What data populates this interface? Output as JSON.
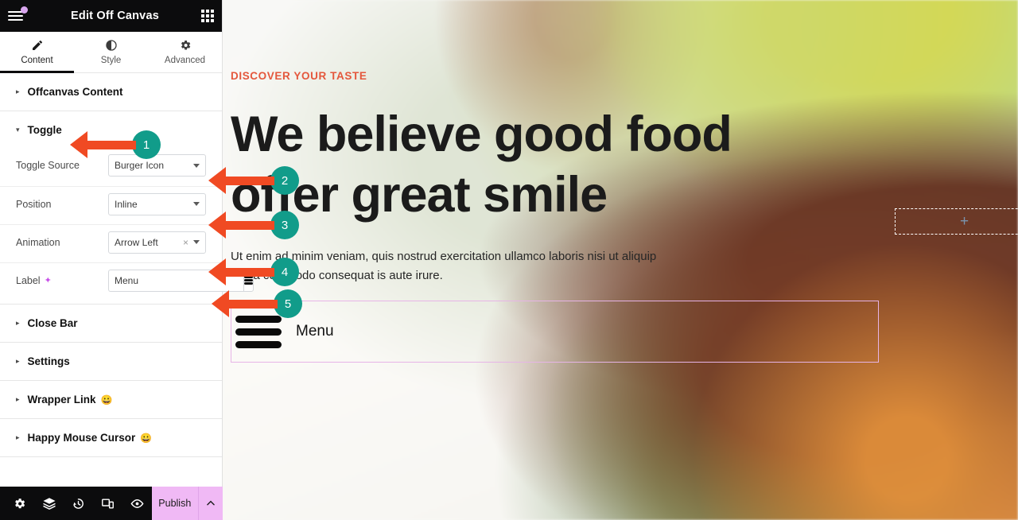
{
  "panel": {
    "header": {
      "title": "Edit Off Canvas",
      "menu_icon": "hamburger-icon",
      "apps_icon": "grid-apps-icon",
      "notification_dot_color": "#d9a6ee"
    },
    "tabs": [
      {
        "label": "Content",
        "icon": "pencil-icon",
        "active": true
      },
      {
        "label": "Style",
        "icon": "contrast-circle-icon",
        "active": false
      },
      {
        "label": "Advanced",
        "icon": "gear-icon",
        "active": false
      }
    ],
    "sections": [
      {
        "title": "Offcanvas Content",
        "state": "collapsed",
        "caret": "▸",
        "emoji": ""
      },
      {
        "title": "Toggle",
        "state": "expanded",
        "caret": "▾",
        "emoji": ""
      },
      {
        "title": "Close Bar",
        "state": "collapsed",
        "caret": "▸",
        "emoji": ""
      },
      {
        "title": "Settings",
        "state": "collapsed",
        "caret": "▸",
        "emoji": ""
      },
      {
        "title": "Wrapper Link",
        "state": "collapsed",
        "caret": "▸",
        "emoji": "😀"
      },
      {
        "title": "Happy Mouse Cursor",
        "state": "collapsed",
        "caret": "▸",
        "emoji": "😀"
      }
    ],
    "toggle_controls": [
      {
        "label": "Toggle Source",
        "type": "select",
        "value": "Burger Icon",
        "clearable": false,
        "sparkle": false
      },
      {
        "label": "Position",
        "type": "select",
        "value": "Inline",
        "clearable": false,
        "sparkle": false
      },
      {
        "label": "Animation",
        "type": "select",
        "value": "Arrow Left",
        "clearable": true,
        "clear_glyph": "×",
        "sparkle": false
      },
      {
        "label": "Label",
        "type": "text",
        "value": "Menu",
        "placeholder": "Menu",
        "sparkle": true,
        "sparkle_glyph": "✦",
        "addon_icon": "database-stack-icon"
      }
    ]
  },
  "bottom_bar": {
    "icons": [
      {
        "name": "settings-gear-icon"
      },
      {
        "name": "navigator-layers-icon"
      },
      {
        "name": "history-clock-icon"
      },
      {
        "name": "responsive-devices-icon"
      },
      {
        "name": "preview-eye-icon"
      }
    ],
    "publish_label": "Publish",
    "publish_caret": "⌃",
    "publish_color": "#f0b9f5"
  },
  "canvas": {
    "eyebrow": "DISCOVER YOUR TASTE",
    "eyebrow_color": "#e4573c",
    "headline": "We believe good food offer great smile",
    "paragraph": "Ut enim ad minim veniam, quis nostrud exercitation ullamco laboris nisi ut aliquip ex ea commodo consequat is aute irure.",
    "menu_widget": {
      "label": "Menu",
      "icon": "burger-lines-icon",
      "selection_border_color": "#e7b4e7"
    },
    "add_element": {
      "glyph": "+"
    }
  },
  "callouts": [
    {
      "number": "1",
      "target": "Toggle section header"
    },
    {
      "number": "2",
      "target": "Toggle Source select"
    },
    {
      "number": "3",
      "target": "Position select"
    },
    {
      "number": "4",
      "target": "Animation select"
    },
    {
      "number": "5",
      "target": "Label input"
    }
  ],
  "colors": {
    "arrow": "#f04a23",
    "badge": "#119c8a",
    "accent_pink": "#f0b9f5"
  }
}
